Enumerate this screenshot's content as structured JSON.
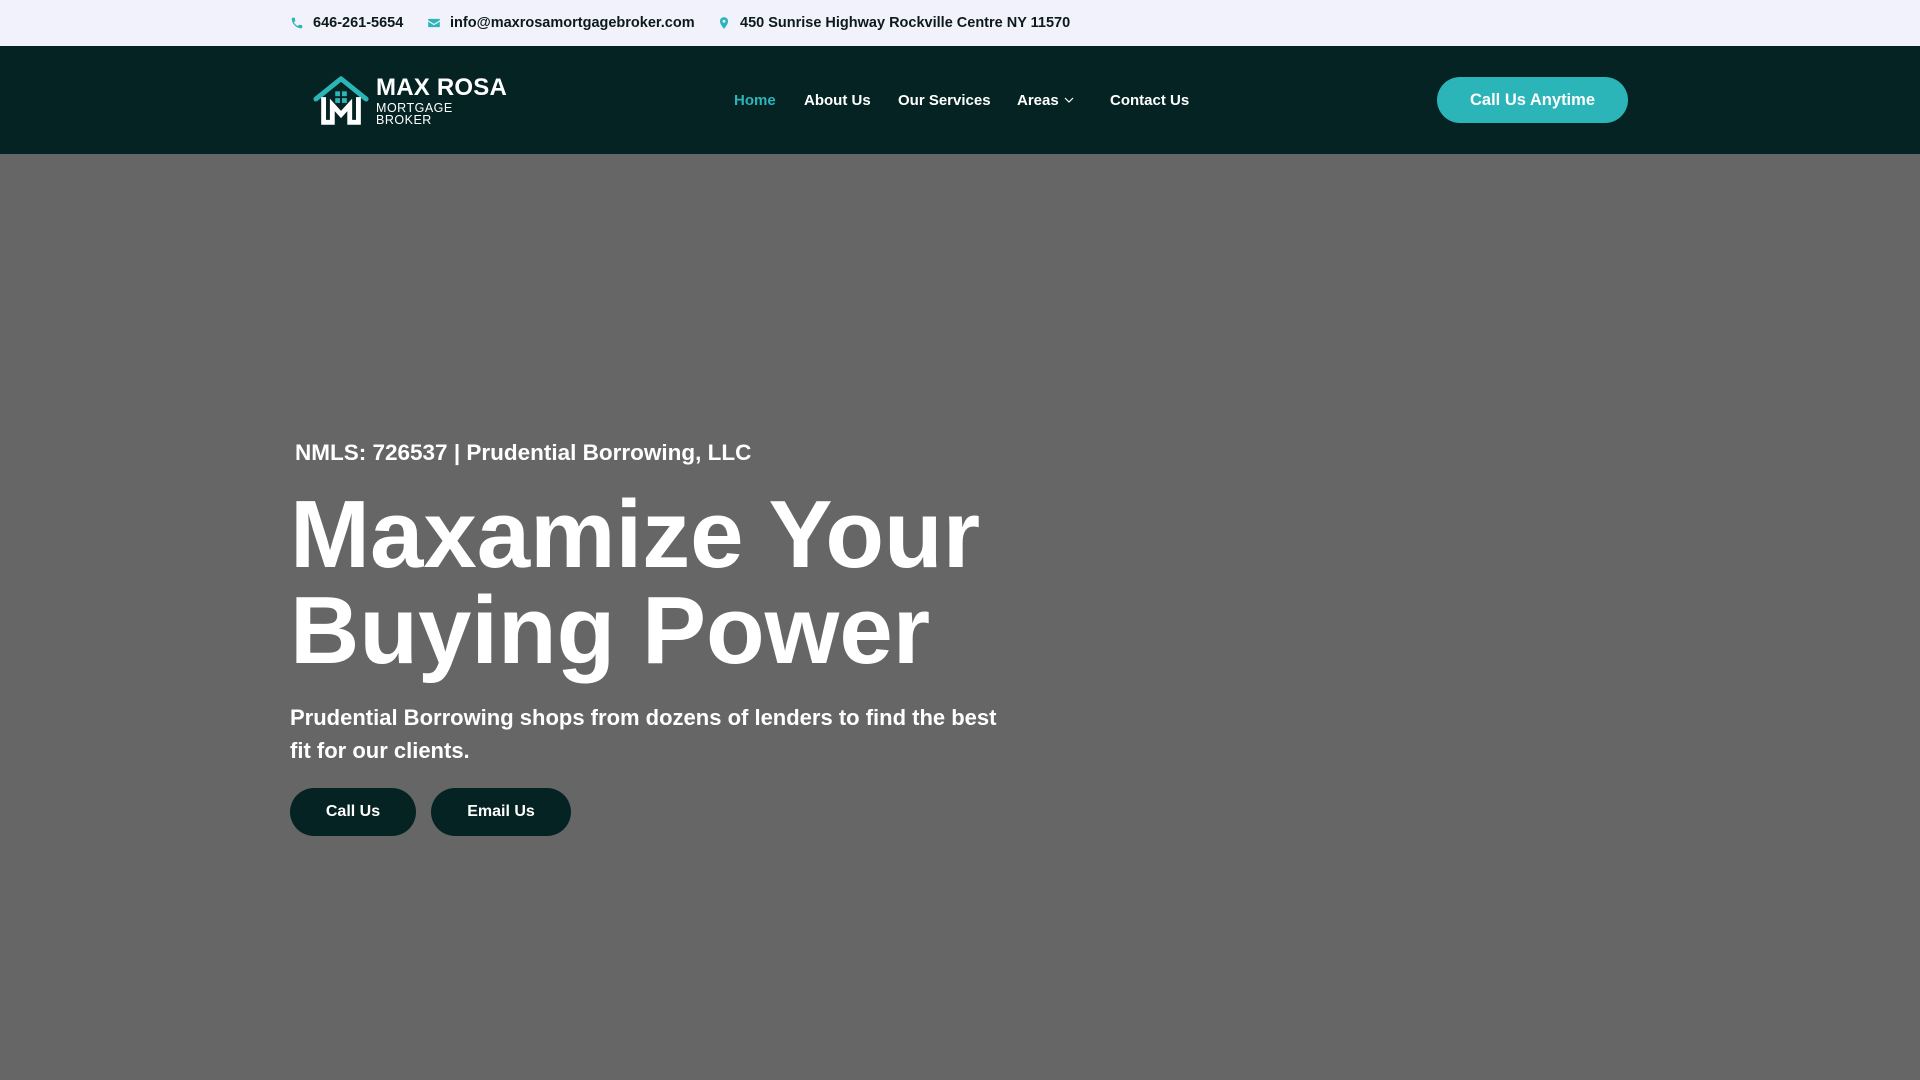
{
  "topbar": {
    "phone": "646-261-5654",
    "email": "info@maxrosamortgagebroker.com",
    "address": "450 Sunrise Highway Rockville Centre NY 11570",
    "phone_icon": "phone-icon",
    "email_icon": "envelope-icon",
    "address_icon": "map-pin-icon"
  },
  "header": {
    "logo": {
      "line1": "MAX ROSA",
      "line2": "MORTGAGE BROKER"
    },
    "nav": [
      {
        "label": "Home",
        "active": true
      },
      {
        "label": "About Us",
        "active": false
      },
      {
        "label": "Our Services",
        "active": false
      },
      {
        "label": "Areas",
        "active": false,
        "dropdown": true
      },
      {
        "label": "Contact Us",
        "active": false
      }
    ],
    "cta_label": "Call Us Anytime"
  },
  "hero": {
    "subheading": "NMLS: 726537 | Prudential Borrowing, LLC",
    "title_line1": "Maxamize Your",
    "title_line2": "Buying Power",
    "description": "Prudential Borrowing shops from dozens of lenders to find the best fit for our clients.",
    "buttons": {
      "call": "Call Us",
      "email": "Email Us"
    }
  },
  "colors": {
    "accent": "#2cb5b8",
    "header_bg": "#042322",
    "topbar_bg": "#f1f2fc",
    "hero_bg": "#666666"
  }
}
